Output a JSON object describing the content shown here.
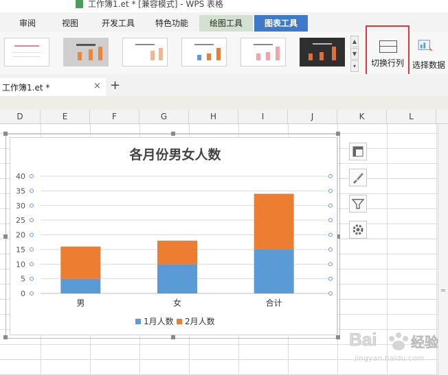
{
  "window": {
    "title": "工作簿1.et * [兼容模式] - WPS 表格"
  },
  "menu": {
    "tabs": [
      {
        "label": "审阅"
      },
      {
        "label": "视图"
      },
      {
        "label": "开发工具"
      },
      {
        "label": "特色功能"
      },
      {
        "label": "绘图工具"
      },
      {
        "label": "图表工具"
      }
    ]
  },
  "ribbon": {
    "switch_row_col": "切换行列",
    "select_data": "选择数据"
  },
  "file_tab": {
    "name": "工作簿1.et *",
    "close": "×",
    "new": "+"
  },
  "columns": [
    "D",
    "E",
    "F",
    "G",
    "H",
    "I",
    "J",
    "K",
    "L"
  ],
  "chart_data": {
    "type": "bar",
    "stacked": true,
    "title": "各月份男女人数",
    "categories": [
      "男",
      "女",
      "合计"
    ],
    "series": [
      {
        "name": "1月人数",
        "values": [
          5,
          10,
          15
        ],
        "color": "#5b9bd5"
      },
      {
        "name": "2月人数",
        "values": [
          11,
          8,
          19
        ],
        "color": "#ed7d31"
      }
    ],
    "ylim": [
      0,
      40
    ],
    "yticks": [
      "0",
      "5",
      "10",
      "15",
      "20",
      "25",
      "30",
      "35",
      "40"
    ],
    "grid": true,
    "legend": "bottom"
  },
  "watermark": {
    "brand": "Bai",
    "cn": "经验",
    "domain": "jingyan.baidu.com"
  }
}
